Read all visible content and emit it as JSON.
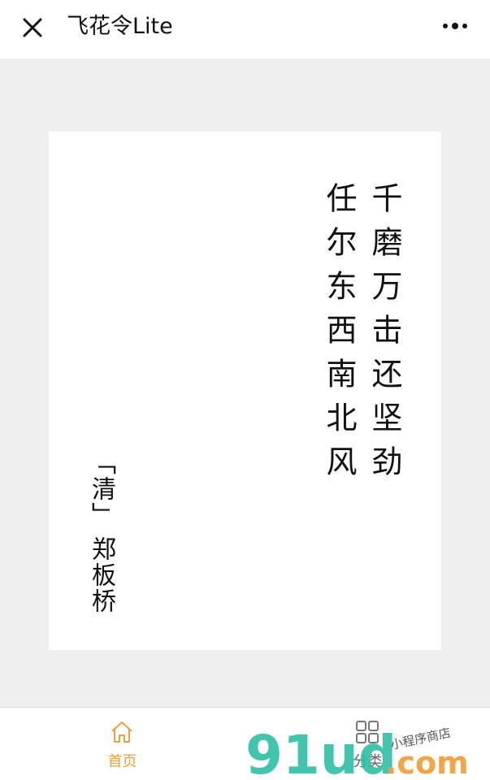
{
  "header": {
    "title": "飞花令Lite",
    "close_icon": "close-icon",
    "more_icon": "more-dots-icon"
  },
  "poem": {
    "lines": [
      "千磨万击还坚劲",
      "任尔东西南北风"
    ],
    "dynasty": "「清」",
    "poet": "郑板桥"
  },
  "tabbar": {
    "items": [
      {
        "label": "首页",
        "icon": "home-icon",
        "active": true
      },
      {
        "label": "分类",
        "icon": "grid-icon",
        "active": false
      }
    ],
    "active_color": "#e8a33c",
    "inactive_color": "#666666"
  },
  "watermark": {
    "brand": "91ud",
    "suffix": ".com",
    "tagline": "小程序商店"
  }
}
